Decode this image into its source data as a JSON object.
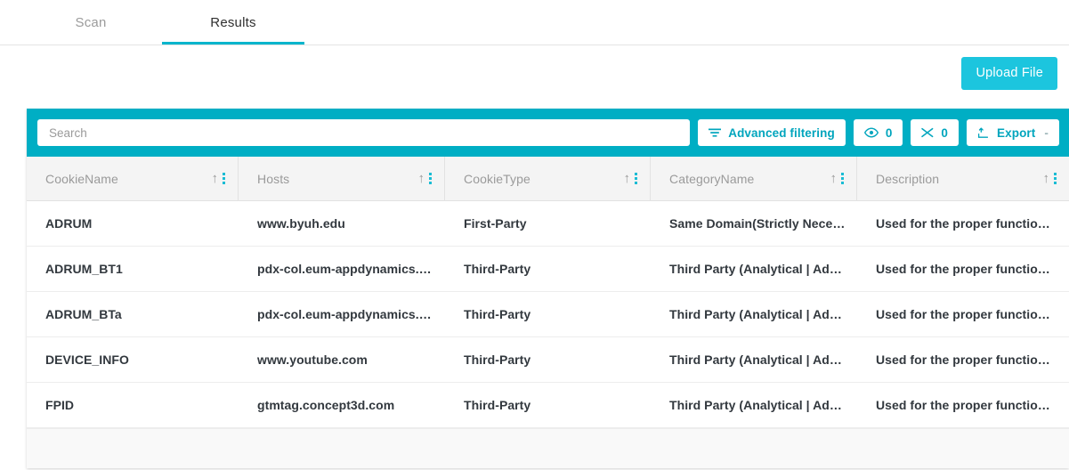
{
  "tabs": [
    {
      "label": "Scan",
      "active": false
    },
    {
      "label": "Results",
      "active": true
    }
  ],
  "actions": {
    "upload_file_label": "Upload File"
  },
  "toolbar": {
    "search_placeholder": "Search",
    "search_value": "",
    "advanced_filtering_label": "Advanced filtering",
    "advanced_filtering_icon": "filter-icon",
    "visible_columns_count": "0",
    "visible_columns_icon": "eye-icon",
    "hidden_columns_count": "0",
    "hidden_columns_icon": "shuffle-icon",
    "export_label": "Export",
    "export_icon": "export-upload-icon",
    "export_caret": "-"
  },
  "table": {
    "columns": [
      {
        "label": "CookieName"
      },
      {
        "label": "Hosts"
      },
      {
        "label": "CookieType"
      },
      {
        "label": "CategoryName"
      },
      {
        "label": "Description"
      }
    ],
    "sort_icon": "sort-arrow-up-icon",
    "menu_icon": "kebab-menu-icon",
    "rows": [
      {
        "cookie_name": "ADRUM",
        "hosts": "www.byuh.edu",
        "cookie_type": "First-Party",
        "category_name": "Same Domain(Strictly Nece…",
        "description": "Used for the proper functio…"
      },
      {
        "cookie_name": "ADRUM_BT1",
        "hosts": "pdx-col.eum-appdynamics.…",
        "cookie_type": "Third-Party",
        "category_name": "Third Party (Analytical | Adv…",
        "description": "Used for the proper functio…"
      },
      {
        "cookie_name": "ADRUM_BTa",
        "hosts": "pdx-col.eum-appdynamics.…",
        "cookie_type": "Third-Party",
        "category_name": "Third Party (Analytical | Adv…",
        "description": "Used for the proper functio…"
      },
      {
        "cookie_name": "DEVICE_INFO",
        "hosts": "www.youtube.com",
        "cookie_type": "Third-Party",
        "category_name": "Third Party (Analytical | Adv…",
        "description": "Used for the proper functio…"
      },
      {
        "cookie_name": "FPID",
        "hosts": "gtmtag.concept3d.com",
        "cookie_type": "Third-Party",
        "category_name": "Third Party (Analytical | Adv…",
        "description": "Used for the proper functio…"
      }
    ]
  },
  "colors": {
    "accent_toolbar": "#00aec4",
    "accent_button": "#1cc5de",
    "accent_tab_underline": "#00b5cc",
    "kebab_icon": "#19bcd4",
    "link_text": "#00a5bd"
  }
}
